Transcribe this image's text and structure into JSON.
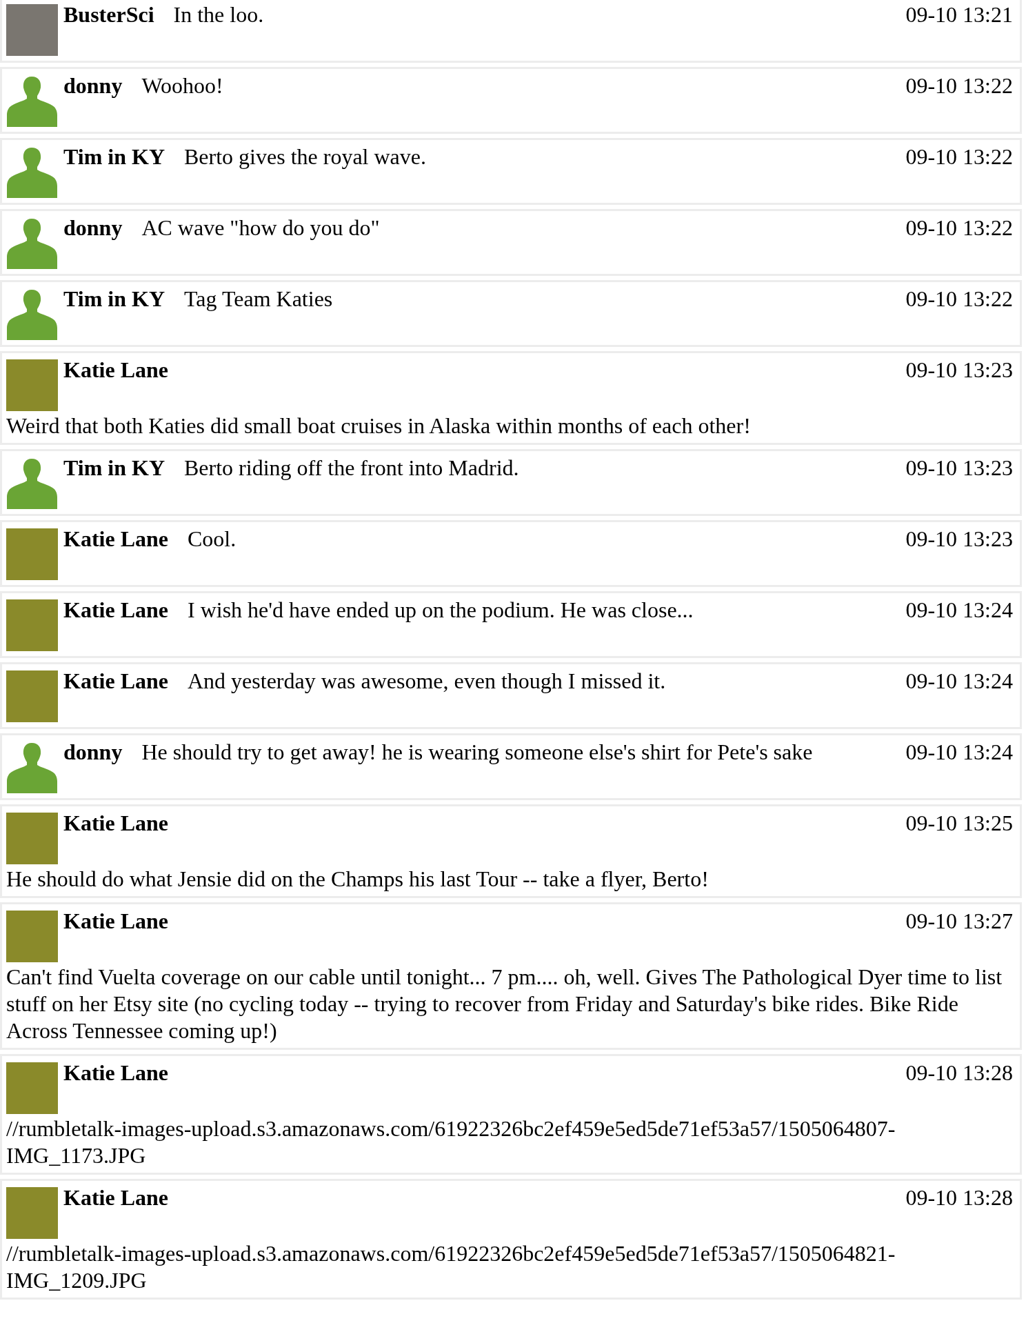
{
  "messages": [
    {
      "author": "BusterSci",
      "avatar": {
        "kind": "photo",
        "color": "#7a7670"
      },
      "text": "In the loo.",
      "time": "09-10 13:21"
    },
    {
      "author": "donny",
      "avatar": {
        "kind": "default"
      },
      "text": "Woohoo!",
      "time": "09-10 13:22"
    },
    {
      "author": "Tim in KY",
      "avatar": {
        "kind": "default"
      },
      "text": "Berto gives the royal wave.",
      "time": "09-10 13:22"
    },
    {
      "author": "donny",
      "avatar": {
        "kind": "default"
      },
      "text": "AC wave \"how do you do\"",
      "time": "09-10 13:22"
    },
    {
      "author": "Tim in KY",
      "avatar": {
        "kind": "default"
      },
      "text": "Tag Team Katies",
      "time": "09-10 13:22"
    },
    {
      "author": "Katie Lane",
      "avatar": {
        "kind": "photo",
        "color": "#8a8a2a"
      },
      "text": "Weird that both Katies did small boat cruises in Alaska within months of each other!",
      "time": "09-10 13:23"
    },
    {
      "author": "Tim in KY",
      "avatar": {
        "kind": "default"
      },
      "text": "Berto riding off the front into Madrid.",
      "time": "09-10 13:23"
    },
    {
      "author": "Katie Lane",
      "avatar": {
        "kind": "photo",
        "color": "#8a8a2a"
      },
      "text": "Cool.",
      "time": "09-10 13:23"
    },
    {
      "author": "Katie Lane",
      "avatar": {
        "kind": "photo",
        "color": "#8a8a2a"
      },
      "text": "I wish he'd have ended up on the podium. He was close...",
      "time": "09-10 13:24"
    },
    {
      "author": "Katie Lane",
      "avatar": {
        "kind": "photo",
        "color": "#8a8a2a"
      },
      "text": "And yesterday was awesome, even though I missed it.",
      "time": "09-10 13:24"
    },
    {
      "author": "donny",
      "avatar": {
        "kind": "default"
      },
      "text": "He should try to get away! he is wearing someone else's shirt for Pete's sake",
      "time": "09-10 13:24"
    },
    {
      "author": "Katie Lane",
      "avatar": {
        "kind": "photo",
        "color": "#8a8a2a"
      },
      "text": "He should do what Jensie did on the Champs his last Tour -- take a flyer, Berto!",
      "time": "09-10 13:25"
    },
    {
      "author": "Katie Lane",
      "avatar": {
        "kind": "photo",
        "color": "#8a8a2a"
      },
      "text": "Can't find Vuelta coverage on our cable until tonight... 7 pm.... oh, well. Gives The Pathological Dyer time to list stuff on her Etsy site (no cycling today -- trying to recover from Friday and Saturday's bike rides. Bike Ride Across Tennessee coming up!)",
      "time": "09-10 13:27"
    },
    {
      "author": "Katie Lane",
      "avatar": {
        "kind": "photo",
        "color": "#8a8a2a"
      },
      "text": "//rumbletalk-images-upload.s3.amazonaws.com/61922326bc2ef459e5ed5de71ef53a57/1505064807-IMG_1173.JPG",
      "time": "09-10 13:28"
    },
    {
      "author": "Katie Lane",
      "avatar": {
        "kind": "photo",
        "color": "#8a8a2a"
      },
      "text": "//rumbletalk-images-upload.s3.amazonaws.com/61922326bc2ef459e5ed5de71ef53a57/1505064821-IMG_1209.JPG",
      "time": "09-10 13:28"
    }
  ]
}
